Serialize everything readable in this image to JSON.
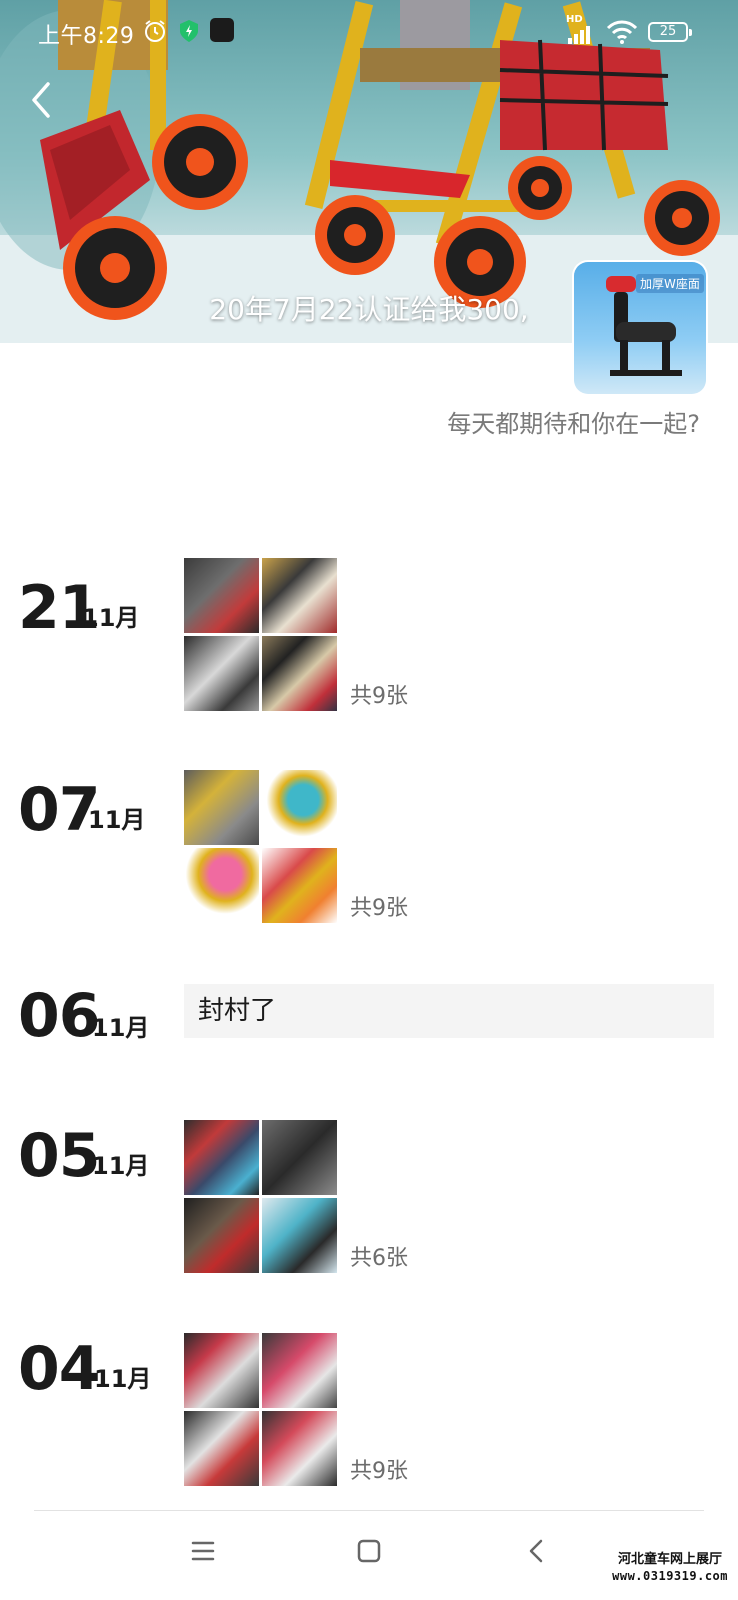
{
  "status_bar": {
    "time": "上午8:29",
    "network": "HD",
    "battery": "25"
  },
  "profile": {
    "signature": "20年7月22认证给我300,",
    "motto": "每天都期待和你在一起?",
    "avatar_text": "加厚W座面"
  },
  "posts": [
    {
      "day": "21",
      "month": "11月",
      "type": "album",
      "count": "共9张"
    },
    {
      "day": "07",
      "month": "11月",
      "type": "album",
      "count": "共9张"
    },
    {
      "day": "06",
      "month": "11月",
      "type": "text",
      "text": "封村了"
    },
    {
      "day": "05",
      "month": "11月",
      "type": "album",
      "count": "共6张"
    },
    {
      "day": "04",
      "month": "11月",
      "type": "album",
      "count": "共9张"
    }
  ],
  "watermark": {
    "title": "河北童车网上展厅",
    "url": "www.0319319.com"
  },
  "nav": {
    "menu": "menu-icon",
    "home": "home-icon",
    "back": "back-icon"
  }
}
